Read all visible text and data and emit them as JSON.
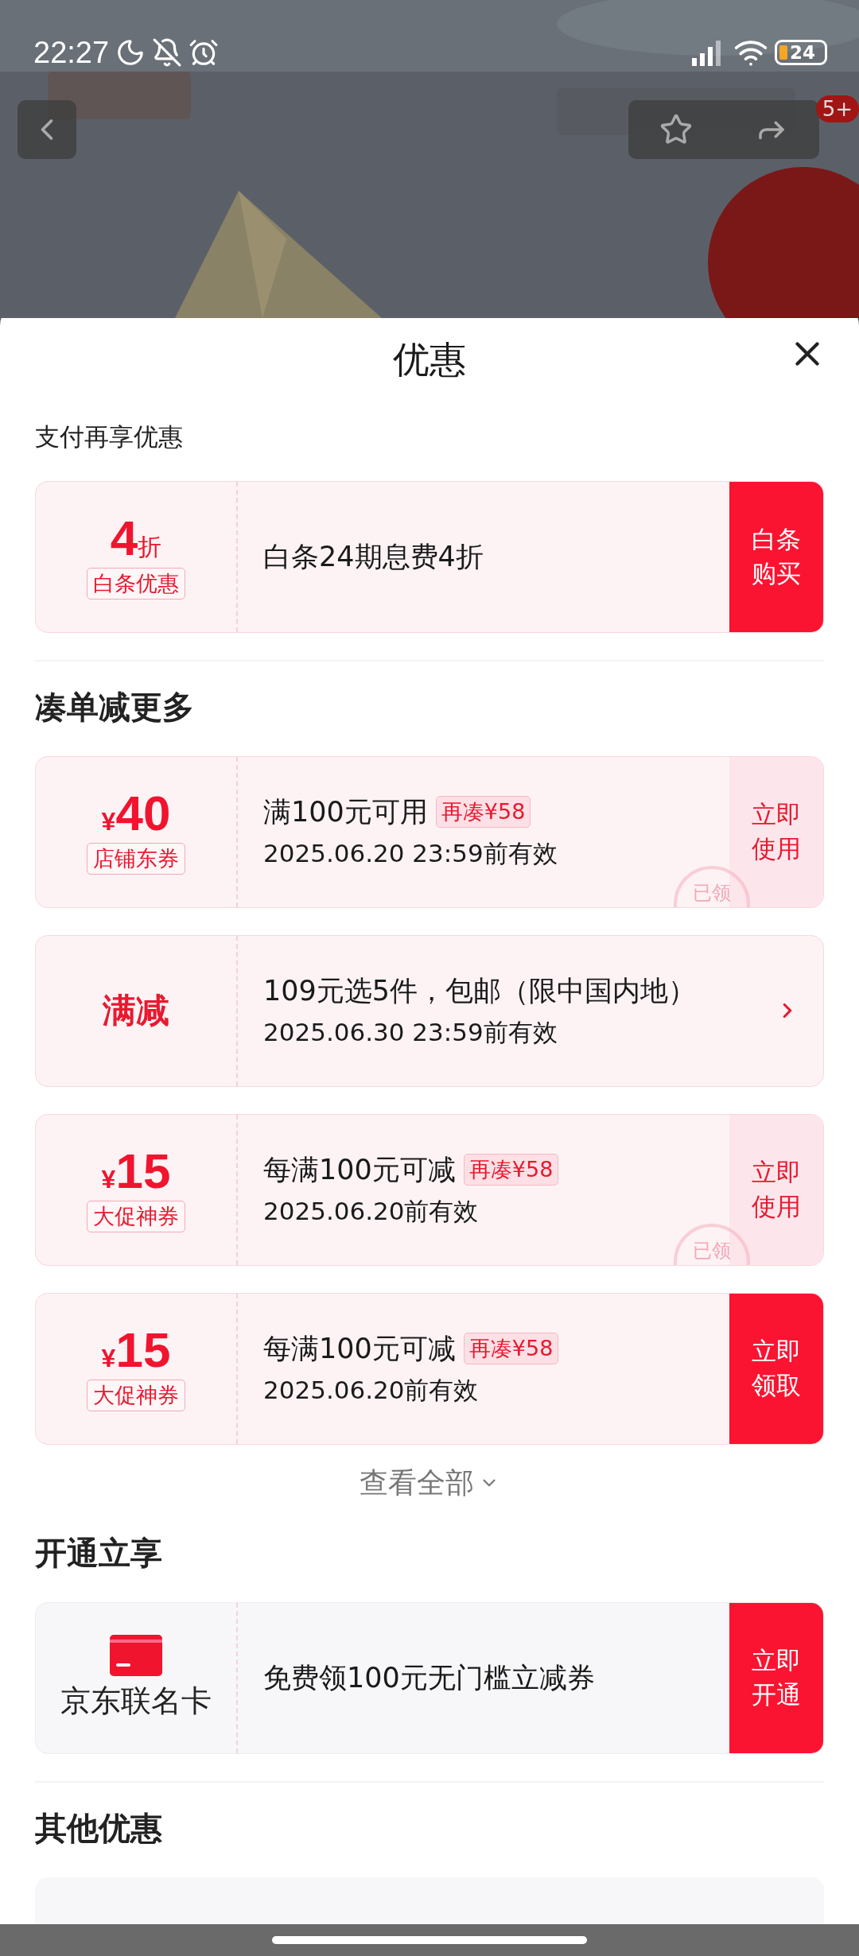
{
  "status_bar": {
    "time": "22:27",
    "battery": "24"
  },
  "header": {
    "cart_badge": "5+"
  },
  "sheet": {
    "title": "优惠",
    "sections": [
      {
        "heading": "支付再享优惠",
        "kind": "minor",
        "cards": [
          {
            "kind": "coupon",
            "left": {
              "kind": "discount",
              "amount": "4",
              "unit": "折",
              "tag": "白条优惠"
            },
            "title": "白条24期息费4折",
            "action": {
              "kind": "filled",
              "label": "白条购买"
            }
          }
        ],
        "divider": true
      },
      {
        "heading": "凑单减更多",
        "kind": "major",
        "cards": [
          {
            "kind": "coupon",
            "left": {
              "kind": "amount",
              "currency": "¥",
              "amount": "40",
              "tag": "店铺东券"
            },
            "title": "满100元可用",
            "chip": "再凑¥58",
            "subtitle": "2025.06.20 23:59前有效",
            "action": {
              "kind": "light",
              "label": "立即使用"
            },
            "stamp": "已领"
          },
          {
            "kind": "coupon",
            "left": {
              "kind": "label",
              "label": "满减"
            },
            "title": "109元选5件，包邮（限中国内地）",
            "subtitle": "2025.06.30 23:59前有效",
            "action": {
              "kind": "chevron"
            }
          },
          {
            "kind": "coupon",
            "left": {
              "kind": "amount",
              "currency": "¥",
              "amount": "15",
              "tag": "大促神券"
            },
            "title": "每满100元可减",
            "chip": "再凑¥58",
            "subtitle": "2025.06.20前有效",
            "action": {
              "kind": "light",
              "label": "立即使用"
            },
            "stamp": "已领"
          },
          {
            "kind": "coupon",
            "left": {
              "kind": "amount",
              "currency": "¥",
              "amount": "15",
              "tag": "大促神券"
            },
            "title": "每满100元可减",
            "chip": "再凑¥58",
            "subtitle": "2025.06.20前有效",
            "action": {
              "kind": "filled",
              "label": "立即领取"
            }
          }
        ],
        "more": "查看全部"
      },
      {
        "heading": "开通立享",
        "kind": "major",
        "cards": [
          {
            "kind": "membership",
            "left": {
              "kind": "card",
              "label": "京东联名卡"
            },
            "title": "免费领100元无门槛立减券",
            "action": {
              "kind": "filled",
              "label": "立即开通"
            }
          }
        ],
        "divider": true
      },
      {
        "heading": "其他优惠",
        "kind": "major"
      }
    ]
  }
}
